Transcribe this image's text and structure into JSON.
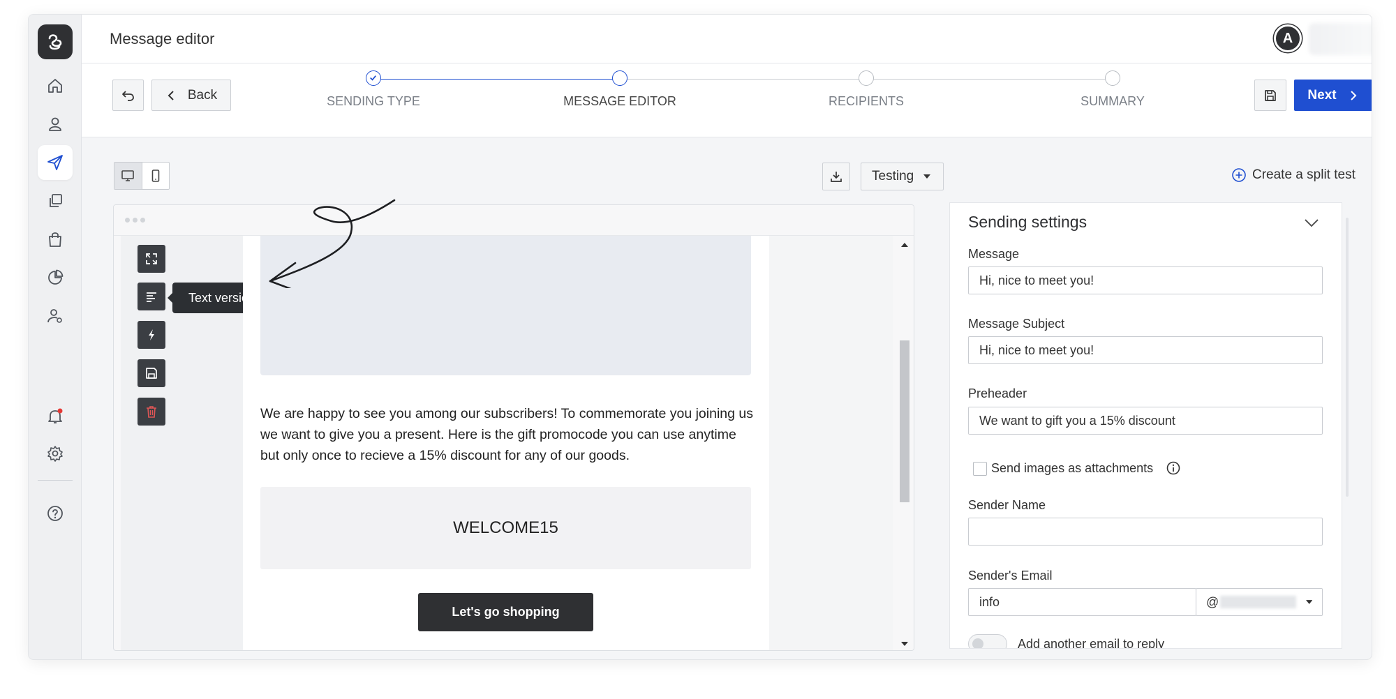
{
  "header": {
    "title": "Message editor",
    "avatar_initial": "A"
  },
  "toolbar": {
    "back_label": "Back",
    "next_label": "Next"
  },
  "steps": [
    {
      "label": "SENDING TYPE",
      "state": "done"
    },
    {
      "label": "MESSAGE EDITOR",
      "state": "current"
    },
    {
      "label": "RECIPIENTS",
      "state": "upcoming"
    },
    {
      "label": "SUMMARY",
      "state": "upcoming"
    }
  ],
  "editor": {
    "testing_label": "Testing",
    "split_test_label": "Create a split test",
    "tooltip": "Text version",
    "tools": [
      "expand-icon",
      "text-version-icon",
      "flash-icon",
      "save-icon",
      "trash-icon"
    ],
    "body_text": "We are happy to see you among our subscribers! To commemorate you joining us we want to give you a present. Here is the gift promocode you can use anytime but only once to recieve a 15% discount for any of our goods.",
    "promo_code": "WELCOME15",
    "cta_label": "Let's go shopping"
  },
  "settings": {
    "title": "Sending settings",
    "message_label": "Message",
    "message_value": "Hi, nice to meet you!",
    "subject_label": "Message Subject",
    "subject_value": "Hi, nice to meet you!",
    "preheader_label": "Preheader",
    "preheader_value": "We want to gift you a 15% discount",
    "images_checkbox_label": "Send images as attachments",
    "sender_name_label": "Sender Name",
    "sender_name_value": "",
    "sender_email_label": "Sender's Email",
    "sender_email_value": "info",
    "domain_prefix": "@",
    "reply_toggle_label": "Add another email to reply"
  },
  "colors": {
    "accent": "#1f4fd1",
    "dark": "#2f3033",
    "notification": "#e53935",
    "danger": "#e05656"
  }
}
